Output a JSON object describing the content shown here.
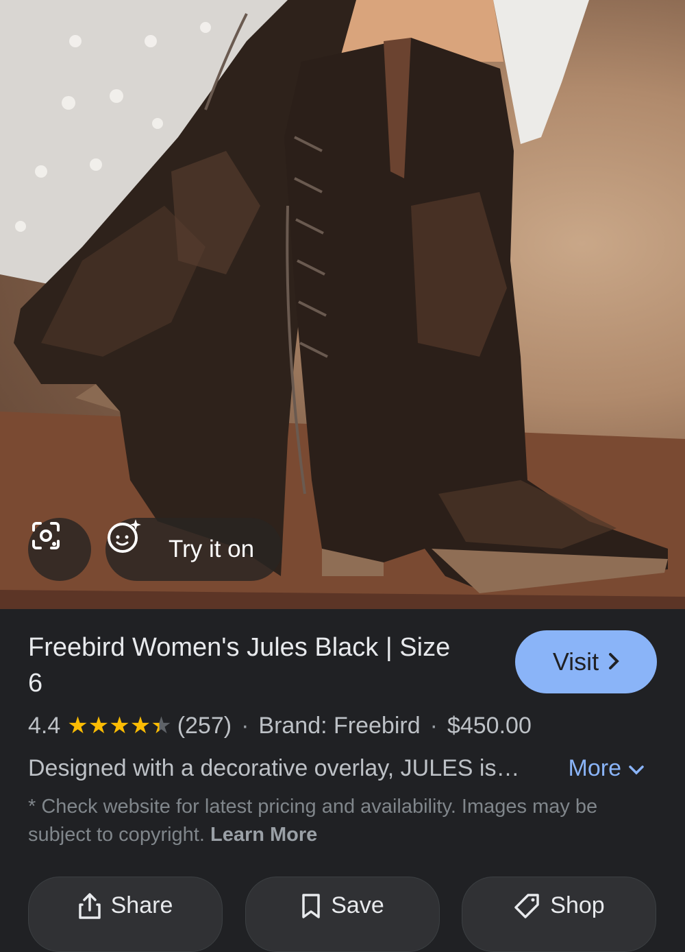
{
  "image_overlay": {
    "lens_icon": "google-lens-icon",
    "try_on": {
      "icon": "sparkle-face-icon",
      "label": "Try it on"
    }
  },
  "product": {
    "title": "Freebird Women's Jules Black | Size 6",
    "visit_label": "Visit",
    "rating": "4.4",
    "rating_value": 4.4,
    "stars_max": 5,
    "review_count": "(257)",
    "brand": "Brand: Freebird",
    "price": "$450.00",
    "description": "Designed with a decorative overlay, JULES is…",
    "more_label": "More",
    "disclaimer": "* Check website for latest pricing and availability. Images may be subject to copyright.",
    "learn_more": "Learn More"
  },
  "actions": [
    {
      "label": "Share",
      "icon": "share-icon"
    },
    {
      "label": "Save",
      "icon": "bookmark-icon"
    },
    {
      "label": "Shop",
      "icon": "tag-icon"
    }
  ],
  "colors": {
    "background": "#202124",
    "accent": "#8ab4f8",
    "star": "#fbbc04"
  }
}
